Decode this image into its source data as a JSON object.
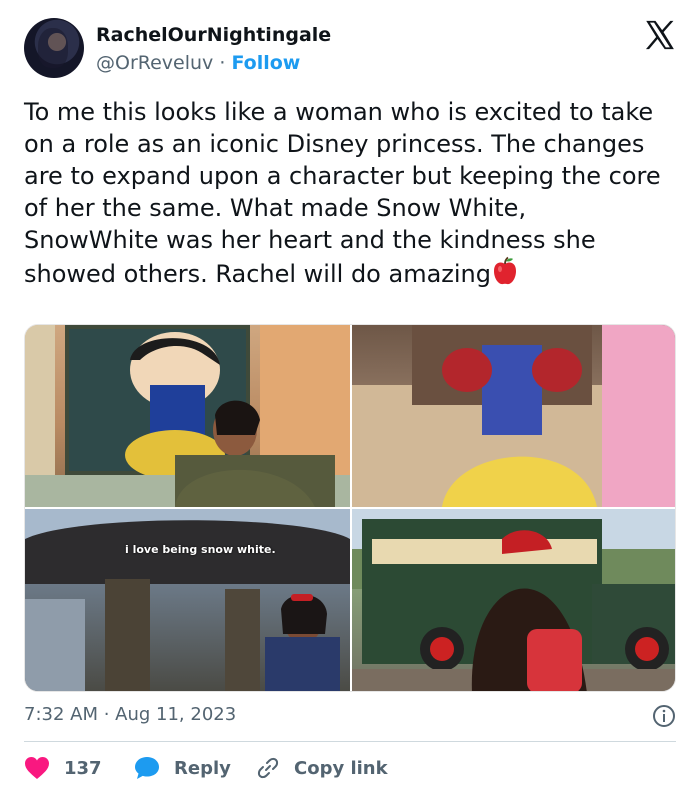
{
  "author": {
    "display_name": "RachelOurNightingale",
    "handle": "@OrReveluv",
    "separator": " · ",
    "follow_label": "Follow"
  },
  "brand_icon": "x-logo-icon",
  "tweet": {
    "text": "To me this looks like a woman who is excited to take on a role as an iconic Disney princess. The changes are to expand upon a character but keeping the core of her the same. What made Snow White, SnowWhite was her heart and the kindness she showed others. Rachel will do amazing",
    "emoji": "red-apple-icon"
  },
  "media": {
    "images": [
      "photo-1",
      "photo-2",
      "photo-3",
      "photo-4"
    ],
    "caption_photo_3": "i love being snow white."
  },
  "meta": {
    "timestamp": "7:32 AM · Aug 11, 2023"
  },
  "actions": {
    "like_count": "137",
    "reply_label": "Reply",
    "copy_label": "Copy link"
  },
  "colors": {
    "accent": "#1d9bf0",
    "like": "#f91880",
    "muted": "#536471",
    "text": "#0f1419"
  }
}
